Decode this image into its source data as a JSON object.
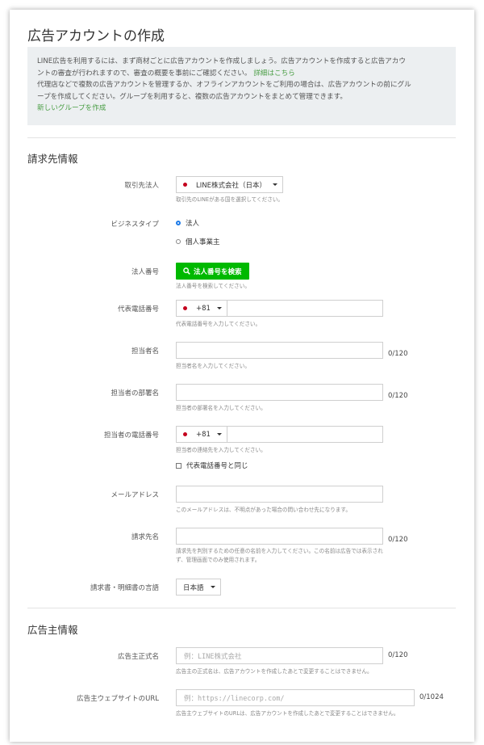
{
  "page": {
    "title": "広告アカウントの作成"
  },
  "notice": {
    "line1": "LINE広告を利用するには、まず商材ごとに広告アカウントを作成しましょう。広告アカウントを作成すると広告アカウ",
    "line2": "ントの審査が行われますので、審査の概要を事前にご確認ください。",
    "review_link": "詳細はこちら",
    "line3": "代理店などで複数の広告アカウントを管理するか、オフラインアカウントをご利用の場合は、広告アカウントの前にグル",
    "line4": "ープを作成してください。グループを利用すると、複数の広告アカウントをまとめて管理できます。",
    "group_link": "新しいグループを作成"
  },
  "billing": {
    "heading": "請求先情報",
    "corp": {
      "label": "取引先法人",
      "value": "LINE株式会社（日本）",
      "help": "取引先のLINEがある国を選択してください。"
    },
    "biz_type": {
      "label": "ビジネスタイプ",
      "options": [
        "法人",
        "個人事業主"
      ],
      "selected": "法人"
    },
    "corp_number": {
      "label": "法人番号",
      "button": "法人番号を検索",
      "help": "法人番号を検索してください。"
    },
    "rep_phone": {
      "label": "代表電話番号",
      "prefix": "+81",
      "value": "",
      "help": "代表電話番号を入力してください。"
    },
    "contact_name": {
      "label": "担当者名",
      "value": "",
      "counter": "0/120",
      "help": "担当者名を入力してください。"
    },
    "contact_dept": {
      "label": "担当者の部署名",
      "value": "",
      "counter": "0/120",
      "help": "担当者の部署名を入力してください。"
    },
    "contact_phone": {
      "label": "担当者の電話番号",
      "prefix": "+81",
      "value": "",
      "help": "担当者の連絡先を入力してください。",
      "same_as_rep": "代表電話番号と同じ"
    },
    "email": {
      "label": "メールアドレス",
      "value": "",
      "help": "このメールアドレスは、不明点があった場合の問い合わせ先になります。"
    },
    "billing_name": {
      "label": "請求先名",
      "value": "",
      "counter": "0/120",
      "help1": "請求先を判別するための任意の名前を入力してください。この名前は広告では表示され",
      "help2": "ず、管理画面でのみ使用されます。"
    },
    "invoice_lang": {
      "label": "請求書・明細書の言語",
      "value": "日本語"
    }
  },
  "advertiser": {
    "heading": "広告主情報",
    "name": {
      "label": "広告主正式名",
      "placeholder": "例：LINE株式会社",
      "counter": "0/120",
      "help": "広告主の正式名は、広告アカウントを作成したあとで変更することはできません。"
    },
    "website": {
      "label": "広告主ウェブサイトのURL",
      "placeholder": "例：https://linecorp.com/",
      "counter": "0/1024",
      "help": "広告主ウェブサイトのURLは、広告アカウントを作成したあとで変更することはできません。"
    }
  },
  "colors": {
    "accent_green": "#00b900",
    "link_green": "#4a9e45",
    "notice_bg": "#eceff1",
    "flag_red": "#c4001d"
  }
}
